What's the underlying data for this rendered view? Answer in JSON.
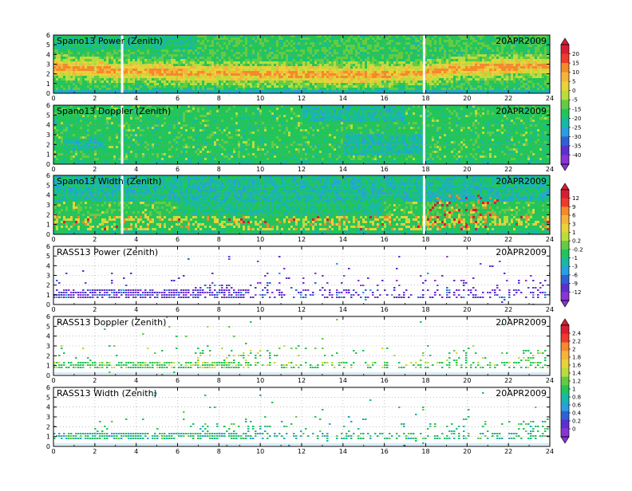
{
  "chart_data": [
    {
      "type": "heatmap",
      "title": "Spano13 Power (Zenith)",
      "date": "20APR2009",
      "x_ticks": [
        "0",
        "2",
        "4",
        "6",
        "8",
        "10",
        "12",
        "14",
        "16",
        "18",
        "20",
        "22",
        "24"
      ],
      "y_ticks": [
        "0",
        "1",
        "2",
        "3",
        "4",
        "5",
        "6"
      ],
      "xlim": [
        0,
        24
      ],
      "ylim": [
        0,
        6
      ],
      "pattern": "power",
      "background": "#22c55a",
      "gaps_hours": [
        3.3,
        17.9
      ],
      "band": [
        [
          0,
          2.7
        ],
        [
          3,
          2.35
        ],
        [
          6,
          2.15
        ],
        [
          9,
          2.0
        ],
        [
          12,
          1.95
        ],
        [
          15,
          1.9
        ],
        [
          18,
          2.1
        ],
        [
          20,
          2.6
        ],
        [
          24,
          2.8
        ]
      ]
    },
    {
      "type": "heatmap",
      "title": "Spano13 Doppler (Zenith)",
      "date": "20APR2009",
      "x_ticks": [
        "0",
        "2",
        "4",
        "6",
        "8",
        "10",
        "12",
        "14",
        "16",
        "18",
        "20",
        "22",
        "24"
      ],
      "y_ticks": [
        "0",
        "1",
        "2",
        "3",
        "4",
        "5",
        "6"
      ],
      "xlim": [
        0,
        24
      ],
      "ylim": [
        0,
        6
      ],
      "pattern": "doppler",
      "background": "#22c55a",
      "gaps_hours": [
        3.3,
        17.9
      ]
    },
    {
      "type": "heatmap",
      "title": "Spano13 Width (Zenith)",
      "date": "20APR2009",
      "x_ticks": [
        "0",
        "2",
        "4",
        "6",
        "8",
        "10",
        "12",
        "14",
        "16",
        "18",
        "20",
        "22",
        "24"
      ],
      "y_ticks": [
        "0",
        "1",
        "2",
        "3",
        "4",
        "5",
        "6"
      ],
      "xlim": [
        0,
        24
      ],
      "ylim": [
        0,
        6
      ],
      "pattern": "width",
      "background": "#22c55a",
      "gaps_hours": [
        3.3,
        17.9
      ]
    },
    {
      "type": "scatter",
      "title": "RASS13 Power (Zenith)",
      "date": "20APR2009",
      "x_ticks": [
        "0",
        "2",
        "4",
        "6",
        "8",
        "10",
        "12",
        "14",
        "16",
        "18",
        "20",
        "22",
        "24"
      ],
      "y_ticks": [
        "0",
        "1",
        "2",
        "3",
        "4",
        "5",
        "6"
      ],
      "xlim": [
        0,
        24
      ],
      "ylim": [
        0,
        6
      ],
      "pattern": "rass_power"
    },
    {
      "type": "scatter",
      "title": "RASS13 Doppler (Zenith)",
      "date": "20APR2009",
      "x_ticks": [
        "0",
        "2",
        "4",
        "6",
        "8",
        "10",
        "12",
        "14",
        "16",
        "18",
        "20",
        "22",
        "24"
      ],
      "y_ticks": [
        "0",
        "1",
        "2",
        "3",
        "4",
        "5",
        "6"
      ],
      "xlim": [
        0,
        24
      ],
      "ylim": [
        0,
        6
      ],
      "pattern": "rass_doppler"
    },
    {
      "type": "scatter",
      "title": "RASS13 Width (Zenith)",
      "date": "20APR2009",
      "x_ticks": [
        "0",
        "2",
        "4",
        "6",
        "8",
        "10",
        "12",
        "14",
        "16",
        "18",
        "20",
        "22",
        "24"
      ],
      "y_ticks": [
        "0",
        "1",
        "2",
        "3",
        "4",
        "5",
        "6"
      ],
      "xlim": [
        0,
        24
      ],
      "ylim": [
        0,
        6
      ],
      "pattern": "rass_width"
    }
  ],
  "colorbars": [
    {
      "labels": [
        "20",
        "15",
        "10",
        "5",
        "0",
        "-5",
        "-15",
        "-20",
        "-25",
        "-30",
        "-35",
        "-40"
      ],
      "colors": [
        "#d81e34",
        "#ef3a2c",
        "#f5892c",
        "#f6b33b",
        "#e9d23a",
        "#b9dd3c",
        "#64cc42",
        "#22c55a",
        "#17b9a5",
        "#2a9fe0",
        "#2f61d6",
        "#5b2fd0",
        "#8a33d6"
      ]
    },
    {
      "labels": [
        "12",
        "9",
        "6",
        "3",
        "1",
        "0.2",
        "-0.2",
        "-1",
        "-3",
        "-6",
        "-9",
        "-12"
      ],
      "colors": [
        "#d81e34",
        "#ef3a2c",
        "#f5892c",
        "#f6b33b",
        "#e9d23a",
        "#b9dd3c",
        "#64cc42",
        "#22c55a",
        "#17b9a5",
        "#2a9fe0",
        "#2f61d6",
        "#5b2fd0",
        "#8a33d6"
      ]
    },
    {
      "labels": [
        "2.4",
        "2.2",
        "2",
        "1.8",
        "1.6",
        "1.4",
        "1.2",
        "1",
        "0.8",
        "0.6",
        "0.4",
        "0.2",
        "0"
      ],
      "colors": [
        "#d81e34",
        "#ef3a2c",
        "#f5892c",
        "#f6b33b",
        "#e9d23a",
        "#b9dd3c",
        "#64cc42",
        "#22c55a",
        "#17b9a5",
        "#2a9fe0",
        "#2f61d6",
        "#5b2fd0",
        "#8a33d6"
      ]
    }
  ]
}
